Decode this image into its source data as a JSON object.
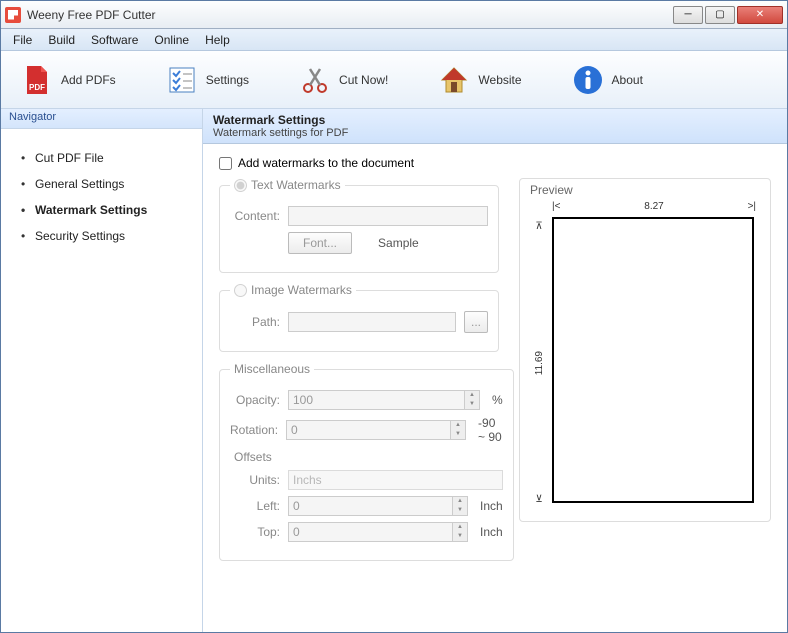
{
  "window": {
    "title": "Weeny Free PDF Cutter"
  },
  "menu": [
    "File",
    "Build",
    "Software",
    "Online",
    "Help"
  ],
  "toolbar": [
    {
      "id": "add-pdfs",
      "label": "Add PDFs"
    },
    {
      "id": "settings",
      "label": "Settings"
    },
    {
      "id": "cut-now",
      "label": "Cut Now!"
    },
    {
      "id": "website",
      "label": "Website"
    },
    {
      "id": "about",
      "label": "About"
    }
  ],
  "sidebar": {
    "header": "Navigator",
    "items": [
      {
        "label": "Cut PDF File",
        "active": false
      },
      {
        "label": "General Settings",
        "active": false
      },
      {
        "label": "Watermark Settings",
        "active": true
      },
      {
        "label": "Security Settings",
        "active": false
      }
    ]
  },
  "content": {
    "title": "Watermark Settings",
    "subtitle": "Watermark settings for PDF",
    "add_watermarks_label": "Add watermarks to the document",
    "add_watermarks_checked": false,
    "text_wm": {
      "legend": "Text Watermarks",
      "content_label": "Content:",
      "content_value": "",
      "font_btn": "Font...",
      "sample": "Sample"
    },
    "image_wm": {
      "legend": "Image Watermarks",
      "path_label": "Path:",
      "path_value": "",
      "browse": "..."
    },
    "misc": {
      "legend": "Miscellaneous",
      "opacity_label": "Opacity:",
      "opacity_value": "100",
      "opacity_unit": "%",
      "rotation_label": "Rotation:",
      "rotation_value": "0",
      "rotation_hint": "-90 ~ 90",
      "offsets_label": "Offsets",
      "units_label": "Units:",
      "units_value": "Inchs",
      "left_label": "Left:",
      "left_value": "0",
      "left_unit": "Inch",
      "top_label": "Top:",
      "top_value": "0",
      "top_unit": "Inch"
    },
    "preview": {
      "title": "Preview",
      "width": "8.27",
      "height": "11.69"
    }
  }
}
